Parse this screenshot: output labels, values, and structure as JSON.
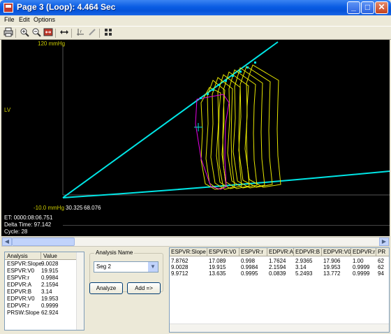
{
  "window": {
    "title": "Page 3 (Loop): 4.464 Sec",
    "minimize": "_",
    "maximize": "□",
    "close": "✕"
  },
  "menu": {
    "file": "File",
    "edit": "Edit",
    "options": "Options"
  },
  "toolbar": {
    "icons": [
      "print-icon",
      "zoom-in-icon",
      "zoom-out-icon",
      "fit-icon",
      "horizontal-arrows-icon",
      "marker-icon",
      "pen-icon",
      "grid-icon"
    ]
  },
  "plot": {
    "axis_labels": {
      "top_left": "120 mmHg",
      "left_mid": "LV",
      "bottom_left": "-10.0 mmHg",
      "x_min": "30.325",
      "x_max": "68.076"
    },
    "colors": {
      "line": "#00e5e5",
      "loops": "#e6e600",
      "reference": "#e600e6",
      "background": "#000000"
    }
  },
  "info": {
    "et": "ET: 0000:08:06.751",
    "delta": "Delta Time:  97.142",
    "cycle": "Cycle: 28"
  },
  "analysis_list": {
    "headers": [
      "Analysis",
      "Value"
    ],
    "rows": [
      [
        "ESPVR:Slope",
        "9.0028"
      ],
      [
        "ESPVR:V0",
        "19.915"
      ],
      [
        "ESPVR:r",
        "0.9984"
      ],
      [
        "EDPVR:A",
        "2.1594"
      ],
      [
        "EDPVR:B",
        "3.14"
      ],
      [
        "EDPVR:V0",
        "19.953"
      ],
      [
        "EDPVR:r",
        "0.9999"
      ],
      [
        "PRSW:Slope",
        "62.924"
      ]
    ]
  },
  "controls": {
    "group_title": "Analysis Name",
    "selected_name": "Seg 2",
    "analyze_label": "Analyze",
    "add_label": "Add =>"
  },
  "results": {
    "headers": [
      "ESPVR:Slope",
      "ESPVR:V0",
      "ESPVR:r",
      "EDPVR:A",
      "EDPVR:B",
      "EDPVR:V0",
      "EDPVR:r",
      "PR"
    ],
    "rows": [
      [
        "7.8762",
        "17.089",
        "0.998",
        "1.7624",
        "2.9365",
        "17.906",
        "1.00",
        "62"
      ],
      [
        "9.0028",
        "19.915",
        "0.9984",
        "2.1594",
        "3.14",
        "19.953",
        "0.9999",
        "62"
      ],
      [
        "9.9712",
        "13.635",
        "0.9995",
        "0.0839",
        "5.2493",
        "13.772",
        "0.9999",
        "94"
      ]
    ]
  }
}
